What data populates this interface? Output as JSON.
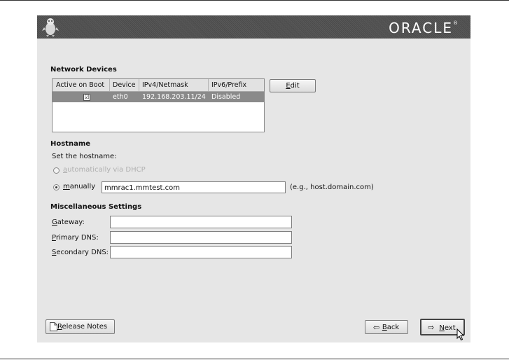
{
  "banner": {
    "brand": "ORACLE",
    "trademark": "®",
    "logo_icon": "penguin-icon"
  },
  "network": {
    "heading": "Network Devices",
    "columns": [
      "Active on Boot",
      "Device",
      "IPv4/Netmask",
      "IPv6/Prefix"
    ],
    "rows": [
      {
        "active": "☑",
        "device": "eth0",
        "ipv4": "192.168.203.11/24",
        "ipv6": "Disabled"
      }
    ],
    "edit_mn": "E",
    "edit_rest": "dit"
  },
  "hostname": {
    "heading": "Hostname",
    "prompt": "Set the hostname:",
    "auto_mn": "a",
    "auto_rest": "utomatically via DHCP",
    "manual_mn": "m",
    "manual_rest": "anually",
    "value": "mmrac1.mmtest.com",
    "example": "(e.g., host.domain.com)"
  },
  "misc": {
    "heading": "Miscellaneous Settings",
    "gateway_mn": "G",
    "gateway_rest": "ateway:",
    "primary_mn": "P",
    "primary_rest": "rimary DNS:",
    "secondary_mn": "S",
    "secondary_rest": "econdary DNS:",
    "gateway_value": "",
    "primary_value": "",
    "secondary_value": ""
  },
  "footer": {
    "release_mn": "R",
    "release_rest": "elease Notes",
    "back_mn": "B",
    "back_rest": "ack",
    "next_mn": "N",
    "next_rest": "ext"
  }
}
